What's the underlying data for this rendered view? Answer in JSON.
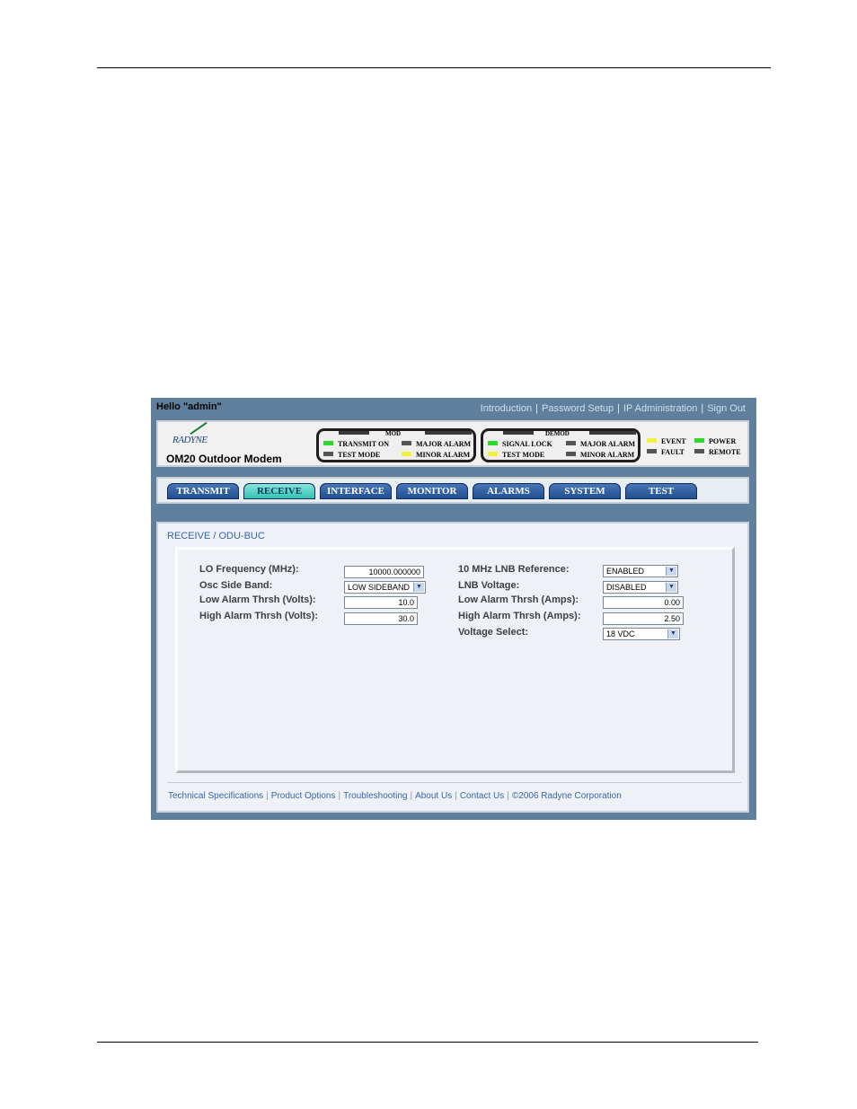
{
  "topbar": {
    "greeting": "Hello \"admin\"",
    "links": [
      "Introduction",
      "Password Setup",
      "IP Administration",
      "Sign Out"
    ]
  },
  "header": {
    "logo_text": "RADYNE",
    "product_name": "OM20 Outdoor Modem",
    "mod_group": {
      "title": "MOD",
      "leds": [
        {
          "label": "TRANSMIT ON",
          "color": "#2ed82e"
        },
        {
          "label": "MAJOR ALARM",
          "color": "#555555"
        },
        {
          "label": "TEST MODE",
          "color": "#555555"
        },
        {
          "label": "MINOR ALARM",
          "color": "#f3f13a"
        }
      ]
    },
    "demod_group": {
      "title": "DEMOD",
      "leds": [
        {
          "label": "SIGNAL LOCK",
          "color": "#2ed82e"
        },
        {
          "label": "MAJOR ALARM",
          "color": "#555555"
        },
        {
          "label": "TEST MODE",
          "color": "#f3f13a"
        },
        {
          "label": "MINOR ALARM",
          "color": "#555555"
        }
      ]
    },
    "status_leds": [
      {
        "label": "EVENT",
        "color": "#f3f13a"
      },
      {
        "label": "POWER",
        "color": "#2ed82e"
      },
      {
        "label": "FAULT",
        "color": "#555555"
      },
      {
        "label": "REMOTE",
        "color": "#555555"
      }
    ]
  },
  "nav": {
    "tabs": [
      "TRANSMIT",
      "RECEIVE",
      "INTERFACE",
      "MONITOR",
      "ALARMS",
      "SYSTEM",
      "TEST"
    ],
    "active": "RECEIVE"
  },
  "content": {
    "breadcrumb": "RECEIVE / ODU-BUC",
    "left": {
      "lo_frequency_label": "LO Frequency (MHz):",
      "lo_frequency_value": "10000.000000",
      "osc_side_band_label": "Osc Side Band:",
      "osc_side_band_value": "LOW SIDEBAND",
      "low_alarm_volts_label": "Low Alarm Thrsh (Volts):",
      "low_alarm_volts_value": "10.0",
      "high_alarm_volts_label": "High Alarm Thrsh (Volts):",
      "high_alarm_volts_value": "30.0"
    },
    "right": {
      "lnb_reference_label": "10 MHz LNB Reference:",
      "lnb_reference_value": "ENABLED",
      "lnb_voltage_label": "LNB Voltage:",
      "lnb_voltage_value": "DISABLED",
      "low_alarm_amps_label": "Low Alarm Thrsh (Amps):",
      "low_alarm_amps_value": "0.00",
      "high_alarm_amps_label": "High Alarm Thrsh (Amps):",
      "high_alarm_amps_value": "2.50",
      "voltage_select_label": "Voltage Select:",
      "voltage_select_value": "18 VDC"
    }
  },
  "footer": {
    "links": [
      "Technical Specifications",
      "Product Options",
      "Troubleshooting",
      "About Us",
      "Contact Us"
    ],
    "copyright": "©2006 Radyne Corporation"
  },
  "icons": {
    "dropdown": "chevron-down-icon"
  }
}
